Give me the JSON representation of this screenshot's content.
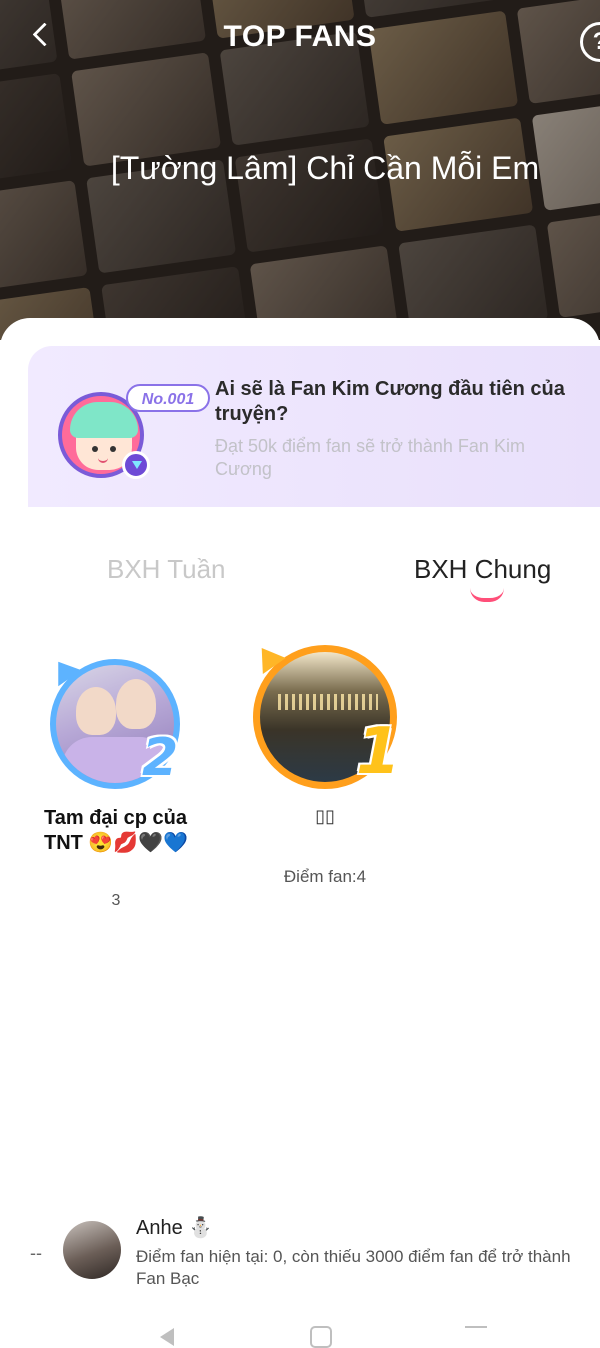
{
  "header": {
    "title": "TOP FANS",
    "help_symbol": "?",
    "back_icon": "chevron-left-icon",
    "story_title": "[Tường Lâm] Chỉ Cần Mỗi Em"
  },
  "banner": {
    "badge": "No.001",
    "heading": "Ai sẽ là Fan Kim Cương đầu tiên của truyện?",
    "subtitle": "Đạt 50k điểm fan sẽ trở thành Fan Kim Cương"
  },
  "tabs": {
    "week": "BXH Tuần",
    "overall": "BXH Chung",
    "active": "overall"
  },
  "ranking": {
    "first": {
      "rank": "1",
      "name": "▯▯",
      "score": "Điểm fan:4"
    },
    "second": {
      "rank": "2",
      "name": "Tam đại cp của TNT 😍💋🖤💙",
      "score": "3"
    }
  },
  "current_user": {
    "rank": "--",
    "name": "Anhe ⛄",
    "status": "Điểm fan hiện tại: 0, còn thiếu 3000 điểm fan để trở thành Fan Bạc"
  },
  "colors": {
    "accent": "#ff4f79",
    "rank1": "#ffb627",
    "rank2": "#5db3ff",
    "banner_bg": "#ece4fc"
  }
}
